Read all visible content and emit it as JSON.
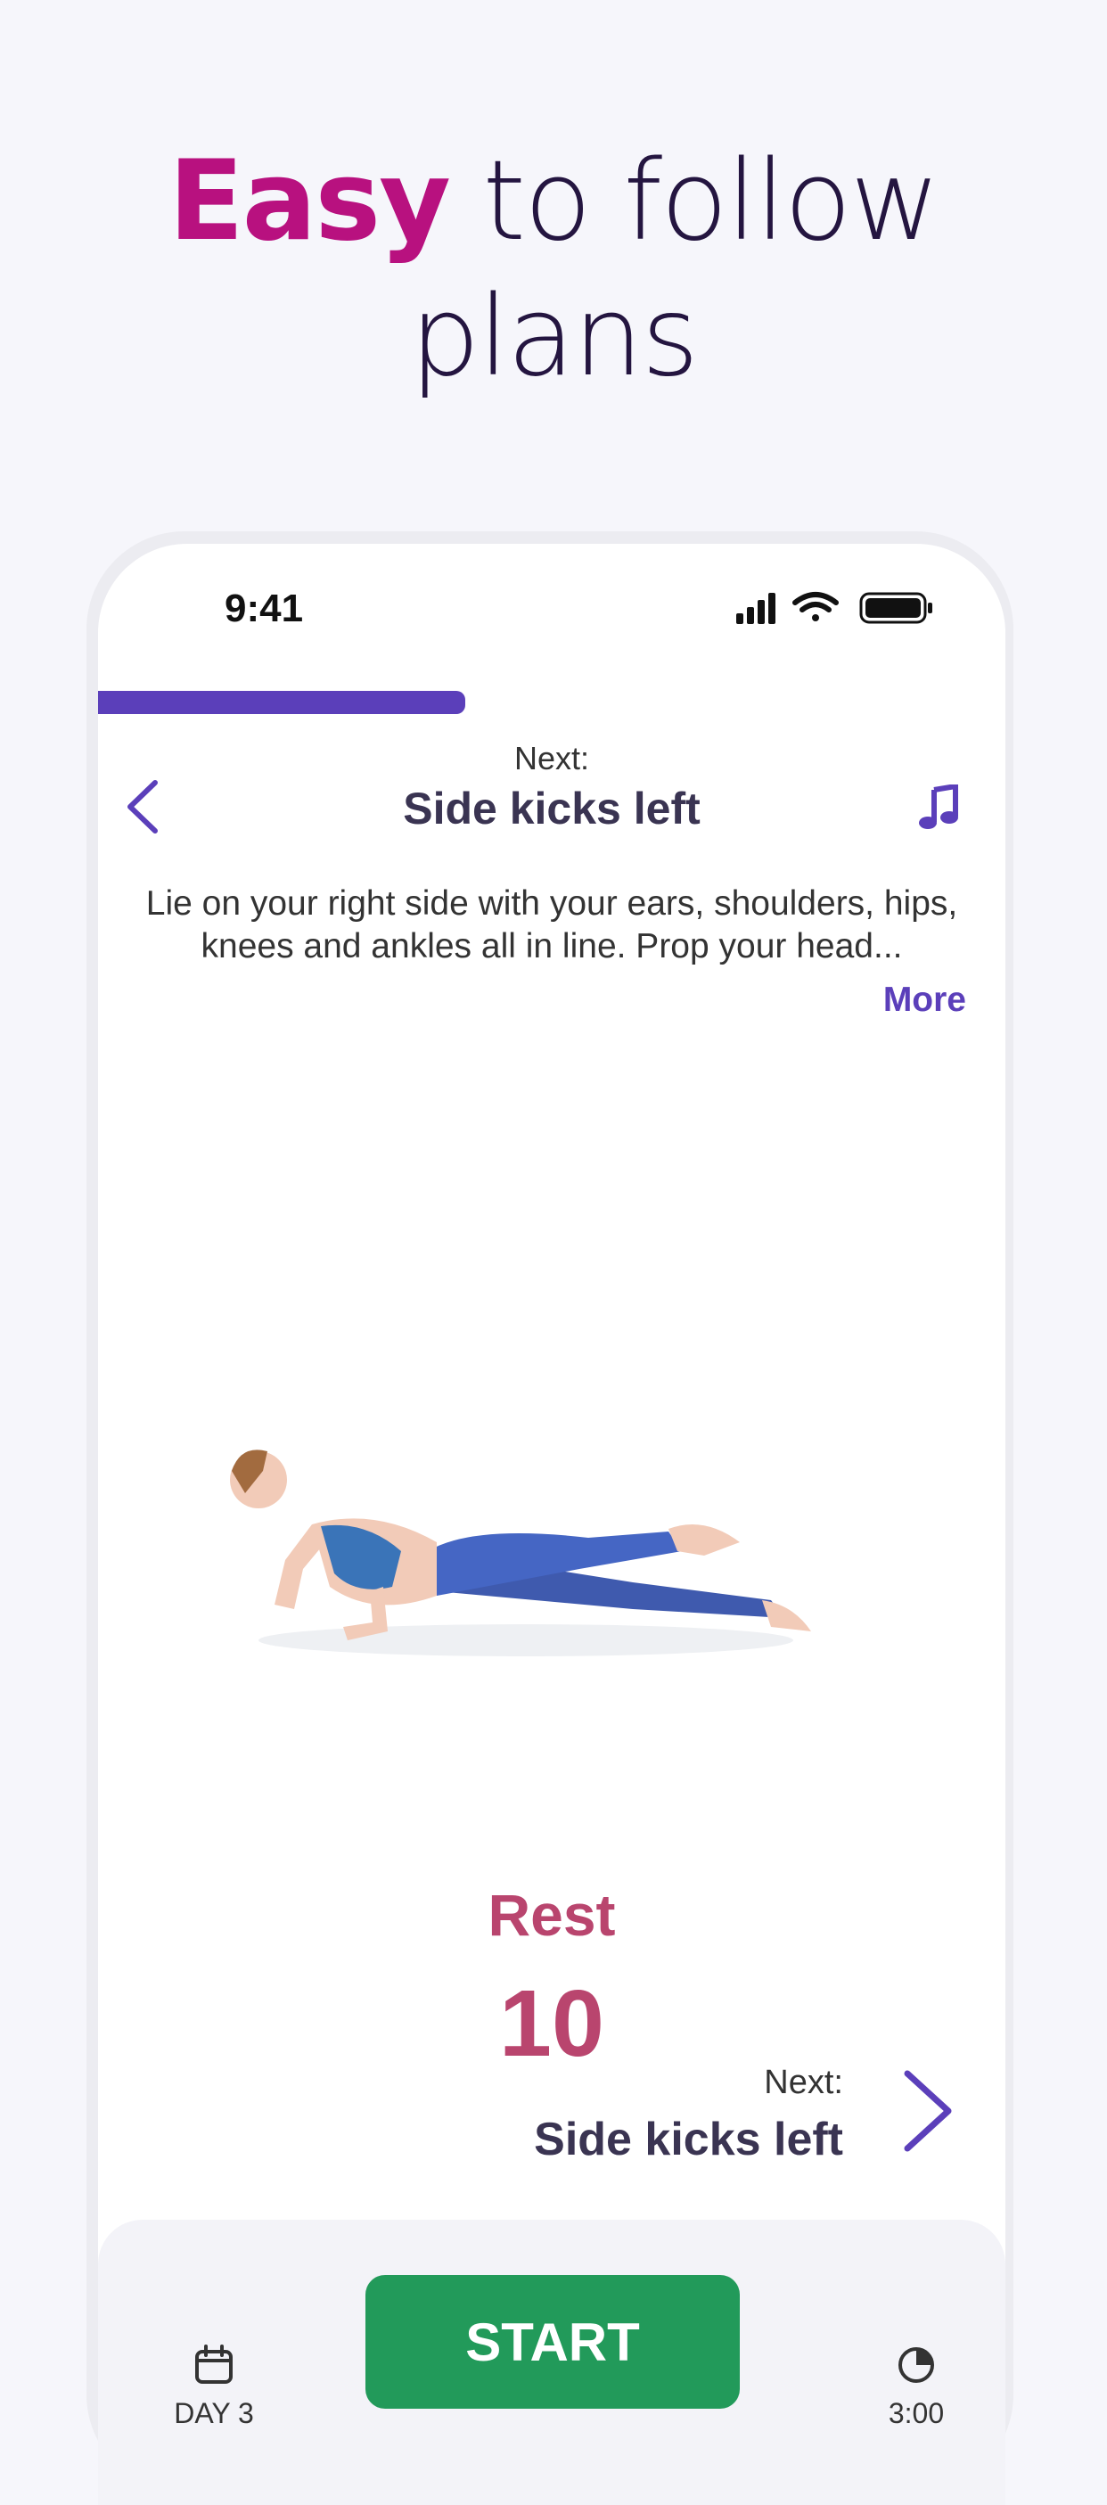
{
  "headline": {
    "accent": "Easy",
    "rest_line1": "to follow",
    "line2": "plans"
  },
  "status_bar": {
    "time": "9:41"
  },
  "workout": {
    "progress_fraction": 0.405,
    "next_label": "Next:",
    "next_title": "Side kicks left",
    "description": "Lie on your right side with your ears, shoulders, hips, knees and ankles all in line.  Prop your head...",
    "more_label": "More",
    "rest_label": "Rest",
    "rest_seconds": "10"
  },
  "bottom_next": {
    "label": "Next:",
    "title": "Side kicks left"
  },
  "bottom_bar": {
    "day_label": "DAY 3",
    "start_label": "START",
    "duration_label": "3:00"
  },
  "colors": {
    "accent": "#b8117f",
    "brand_purple": "#5b3fba",
    "rest": "#b9456e",
    "start_green": "#229a5a"
  }
}
